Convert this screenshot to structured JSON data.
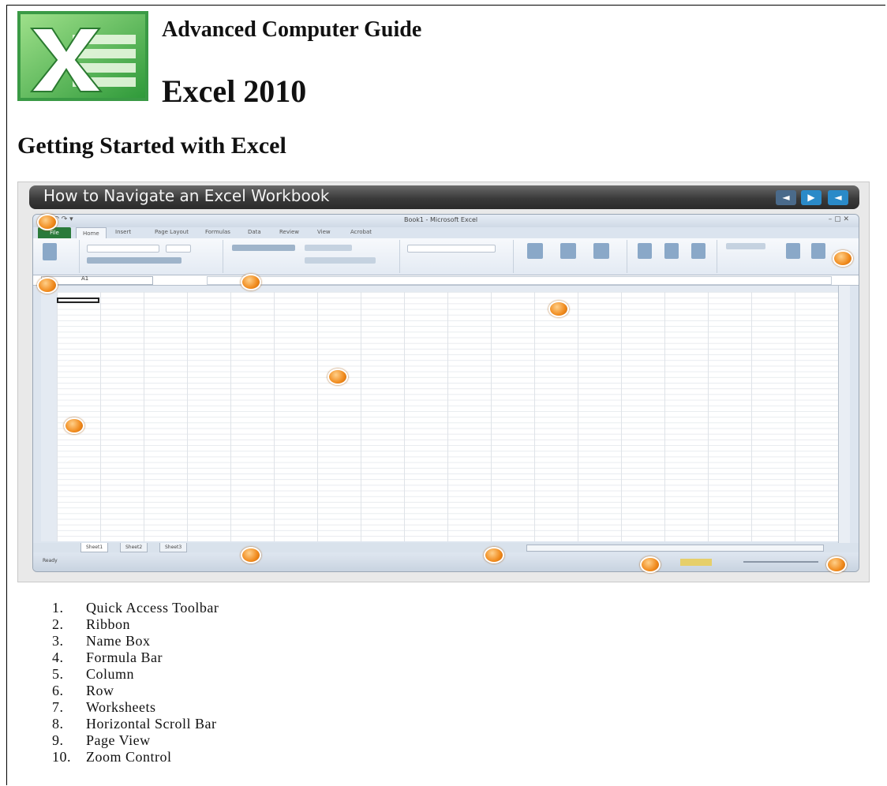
{
  "header": {
    "guide_title": "Advanced Computer Guide",
    "product_title": "Excel 2010"
  },
  "section": {
    "title": "Getting Started with Excel"
  },
  "figure": {
    "title": "How to Navigate an Excel Workbook",
    "controls": {
      "prev_icon": "◄",
      "play_icon": "▶",
      "audio_icon": "◄"
    },
    "window_caption": "Book1 - Microsoft Excel",
    "tabs": [
      "File",
      "Home",
      "Insert",
      "Page Layout",
      "Formulas",
      "Data",
      "Review",
      "View",
      "Acrobat"
    ],
    "name_box": "A1",
    "sheet_tabs": [
      "Sheet1",
      "Sheet2",
      "Sheet3"
    ],
    "status": "Ready",
    "marker_color": "#f08a1c"
  },
  "legend": [
    {
      "num": "1.",
      "label": "Quick Access Toolbar"
    },
    {
      "num": "2.",
      "label": "Ribbon"
    },
    {
      "num": "3.",
      "label": "Name Box"
    },
    {
      "num": "4.",
      "label": "Formula Bar"
    },
    {
      "num": "5.",
      "label": "Column"
    },
    {
      "num": "6.",
      "label": "Row"
    },
    {
      "num": "7.",
      "label": "Worksheets"
    },
    {
      "num": "8.",
      "label": "Horizontal Scroll Bar"
    },
    {
      "num": "9.",
      "label": "Page View"
    },
    {
      "num": "10.",
      "label": "Zoom Control"
    }
  ]
}
